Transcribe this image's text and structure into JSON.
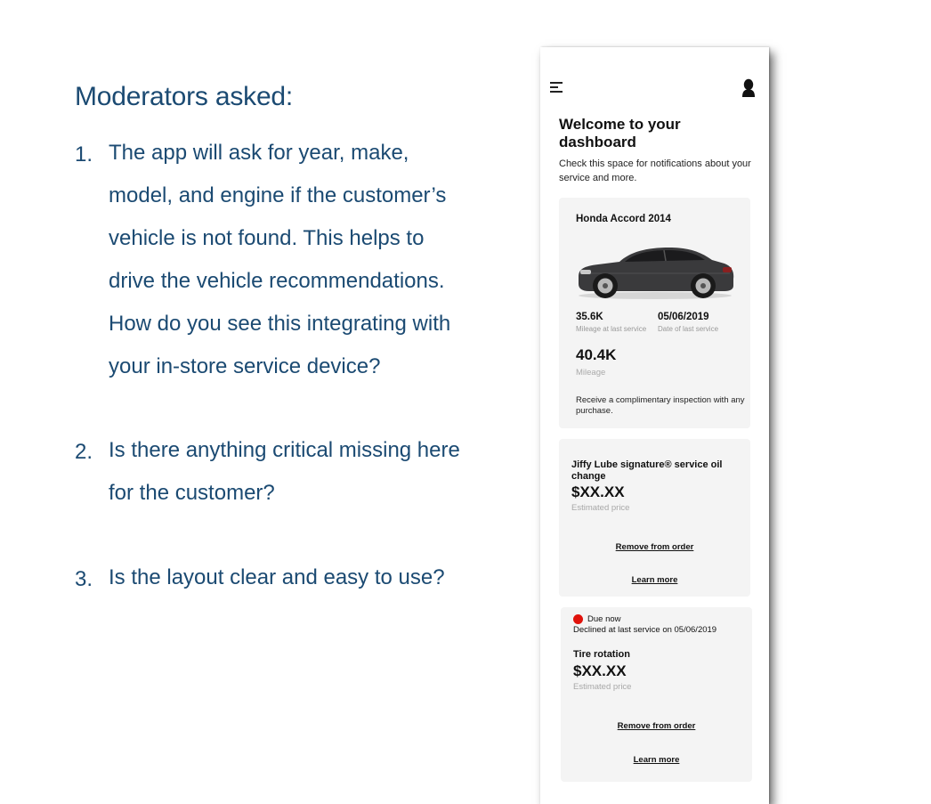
{
  "slide": {
    "title": "Moderators asked:",
    "questions": [
      {
        "num": "1.",
        "lines": [
          "The app will ask for year, make,",
          "model, and engine if the customer’s",
          "vehicle is not found. This helps to",
          "drive the vehicle recommendations.",
          "How do you see this integrating with",
          "your in-store service device?"
        ]
      },
      {
        "num": "2.",
        "lines": [
          "Is there anything critical missing here",
          "for the customer?"
        ]
      },
      {
        "num": "3.",
        "lines": [
          "Is the layout clear and easy to use?"
        ]
      }
    ]
  },
  "app": {
    "icons": {
      "menu": "menu-icon",
      "profile": "user-silhouette-icon"
    },
    "welcome_title": "Welcome to your dashboard",
    "welcome_subtitle": "Check this space for notifications about your service and more.",
    "vehicle_card": {
      "vehicle_name": "Honda Accord 2014",
      "mileage_last_service": "35.6K",
      "mileage_last_service_label": "Mileage at last service",
      "date_last_service": "05/06/2019",
      "date_last_service_label": "Date of last service",
      "mileage": "40.4K",
      "mileage_label": "Mileage",
      "promo": "Receive a complimentary inspection with any purchase."
    },
    "oil_change_card": {
      "service_name": "Jiffy Lube signature® service oil change",
      "price": "$XX.XX",
      "price_label": "Estimated price",
      "remove_label": "Remove from order",
      "learn_more_label": "Learn more"
    },
    "tire_card": {
      "status": "Due now",
      "status_color": "#e0120b",
      "declined_note": "Declined at last service on 05/06/2019",
      "service_name": "Tire rotation",
      "price": "$XX.XX",
      "price_label": "Estimated price",
      "remove_label": "Remove from order",
      "learn_more_label": "Learn more"
    }
  },
  "colors": {
    "slide_text": "#1b4a72",
    "card_background": "#f4f4f4",
    "due_dot": "#e0120b"
  }
}
